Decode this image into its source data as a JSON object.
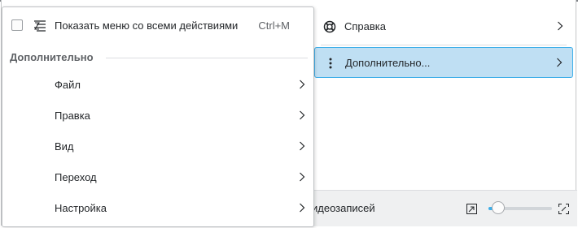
{
  "background_window": {
    "status_label": "идеозаписей",
    "zoom": {
      "level": 0.15
    }
  },
  "parent_menu": {
    "items": [
      {
        "label": "Справка",
        "icon": "lifebuoy-icon",
        "active": false
      },
      {
        "label": "Дополнительно...",
        "icon": "more-vertical-icon",
        "active": true
      }
    ]
  },
  "submenu": {
    "show_all_actions": {
      "label": "Показать меню со всеми действиями",
      "shortcut": "Ctrl+M",
      "checked": false,
      "icon": "menu-list-icon"
    },
    "section_title": "Дополнительно",
    "items": [
      {
        "label": "Файл"
      },
      {
        "label": "Правка"
      },
      {
        "label": "Вид"
      },
      {
        "label": "Переход"
      },
      {
        "label": "Настройка"
      }
    ]
  },
  "colors": {
    "accent": "#3daee9",
    "highlight": "#bfdff3",
    "text": "#232629"
  }
}
